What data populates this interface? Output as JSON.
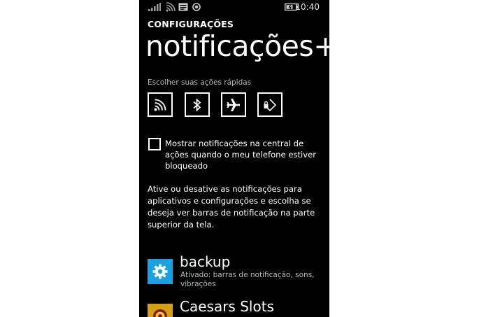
{
  "status_bar": {
    "time": "10:40",
    "icons": [
      "signal-strength-icon",
      "wifi-icon",
      "message-icon",
      "location-icon",
      "battery-icon"
    ]
  },
  "header": {
    "app_title": "CONFIGURAÇÕES",
    "page_title": "notificações+aç"
  },
  "quick_actions": {
    "label": "Escolher suas ações rápidas",
    "items": [
      {
        "name": "wifi-quick-action",
        "icon": "wifi-icon"
      },
      {
        "name": "bluetooth-quick-action",
        "icon": "bluetooth-icon"
      },
      {
        "name": "airplane-mode-quick-action",
        "icon": "airplane-icon"
      },
      {
        "name": "rotation-lock-quick-action",
        "icon": "rotation-lock-icon"
      }
    ]
  },
  "lockscreen_option": {
    "checked": false,
    "label": "Mostrar notificações na central de ações quando o meu telefone estiver bloqueado"
  },
  "description": "Ative ou desative as notificações para aplicativos e configurações e escolha se deseja ver barras de notificação na parte superior da tela.",
  "apps": [
    {
      "name": "backup",
      "status": "Ativado: barras de notificação, sons, vibrações",
      "icon": "gear-icon",
      "tile_color": "#1ba1e2"
    },
    {
      "name": "Caesars Slots",
      "status": "",
      "icon": "caesars-slots-logo-icon",
      "tile_color": "#d4a017"
    }
  ]
}
